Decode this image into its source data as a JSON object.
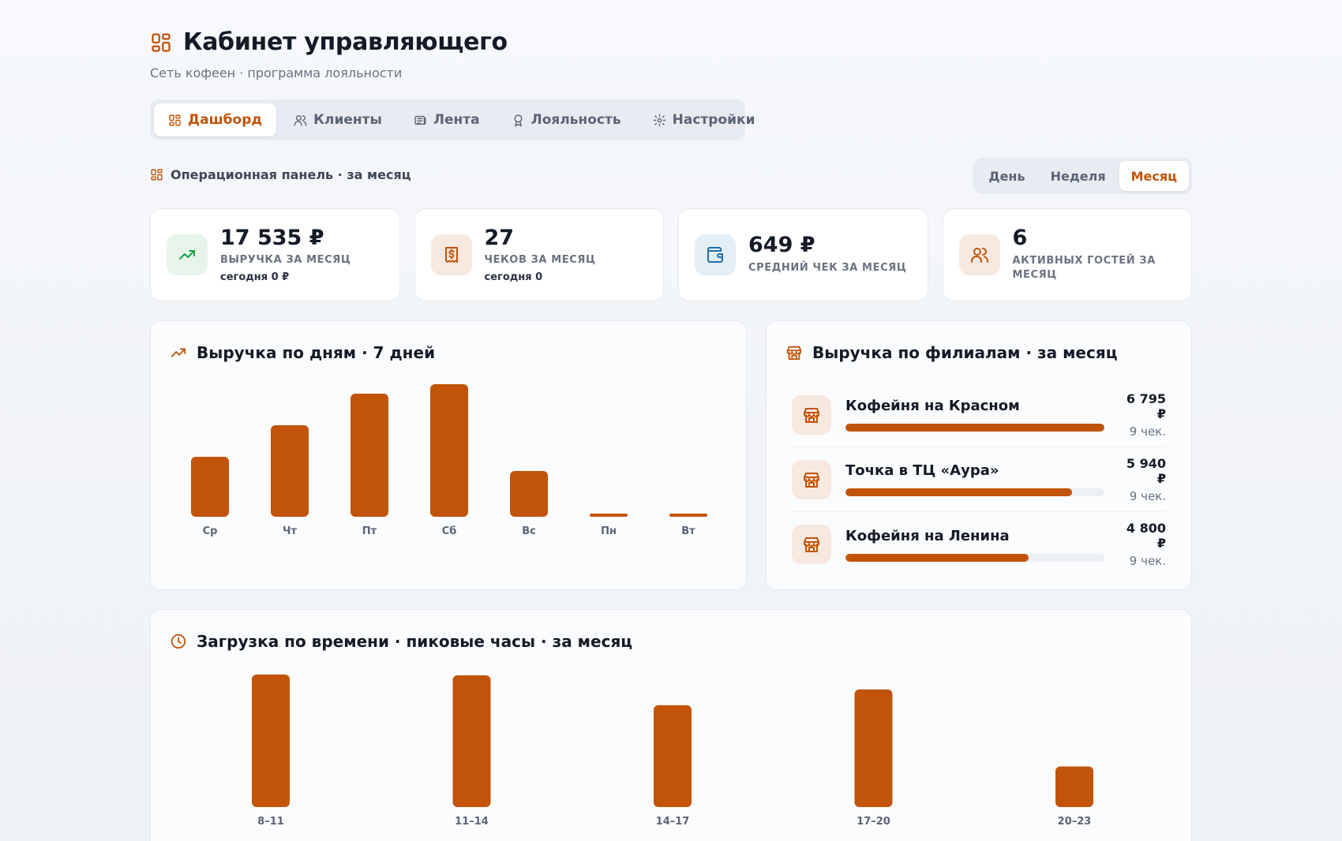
{
  "header": {
    "title": "Кабинет управляющего",
    "subtitle": "Сеть кофеен · программа лояльности"
  },
  "tabs": [
    {
      "label": "Дашборд",
      "icon": "dashboard-icon",
      "active": true
    },
    {
      "label": "Клиенты",
      "icon": "users-icon",
      "active": false
    },
    {
      "label": "Лента",
      "icon": "feed-icon",
      "active": false
    },
    {
      "label": "Лояльность",
      "icon": "award-icon",
      "active": false
    },
    {
      "label": "Настройки",
      "icon": "gear-icon",
      "active": false
    }
  ],
  "section": {
    "title": "Операционная панель · за месяц"
  },
  "periods": [
    {
      "label": "День",
      "active": false
    },
    {
      "label": "Неделя",
      "active": false
    },
    {
      "label": "Месяц",
      "active": true
    }
  ],
  "kpis": [
    {
      "value": "17 535 ₽",
      "label": "Выручка за месяц",
      "sub": "сегодня 0 ₽",
      "icon": "trending-up-icon",
      "icon_bg": "#e6f4ea",
      "icon_color": "#16a34a"
    },
    {
      "value": "27",
      "label": "Чеков за месяц",
      "sub": "сегодня 0",
      "icon": "receipt-icon",
      "icon_bg": "#f7e9e0",
      "icon_color": "#c2540a"
    },
    {
      "value": "649 ₽",
      "label": "Средний чек за месяц",
      "sub": "",
      "icon": "wallet-icon",
      "icon_bg": "#e3eef6",
      "icon_color": "#1f6fa8"
    },
    {
      "value": "6",
      "label": "Активных гостей за месяц",
      "sub": "",
      "icon": "users-icon",
      "icon_bg": "#f7e9e0",
      "icon_color": "#c2540a"
    }
  ],
  "colors": {
    "accent": "#c2540a"
  },
  "revenue_panel": {
    "title": "Выручка по дням · 7 дней"
  },
  "branches_panel": {
    "title": "Выручка по филиалам · за месяц",
    "items": [
      {
        "name": "Кофейня на Красном",
        "amount": "6 795 ₽",
        "checks": "9 чек.",
        "share": 1.0
      },
      {
        "name": "Точка в ТЦ «Аура»",
        "amount": "5 940 ₽",
        "checks": "9 чек.",
        "share": 0.874
      },
      {
        "name": "Кофейня на Ленина",
        "amount": "4 800 ₽",
        "checks": "9 чек.",
        "share": 0.706
      }
    ]
  },
  "load_panel": {
    "title": "Загрузка по времени · пиковые часы · за месяц"
  },
  "chart_data": [
    {
      "type": "bar",
      "categories": [
        "Ср",
        "Чт",
        "Пт",
        "Сб",
        "Вс",
        "Пн",
        "Вт"
      ],
      "values": [
        1900,
        2900,
        3900,
        4200,
        1450,
        60,
        60
      ],
      "ylim": [
        0,
        4200
      ],
      "grid": false
    },
    {
      "type": "bar",
      "categories": [
        "8–11",
        "11–14",
        "14–17",
        "17–20",
        "20–23"
      ],
      "values": [
        8.0,
        7.95,
        6.15,
        7.1,
        2.45
      ],
      "ylim": [
        0,
        8.0
      ],
      "grid": false
    }
  ]
}
